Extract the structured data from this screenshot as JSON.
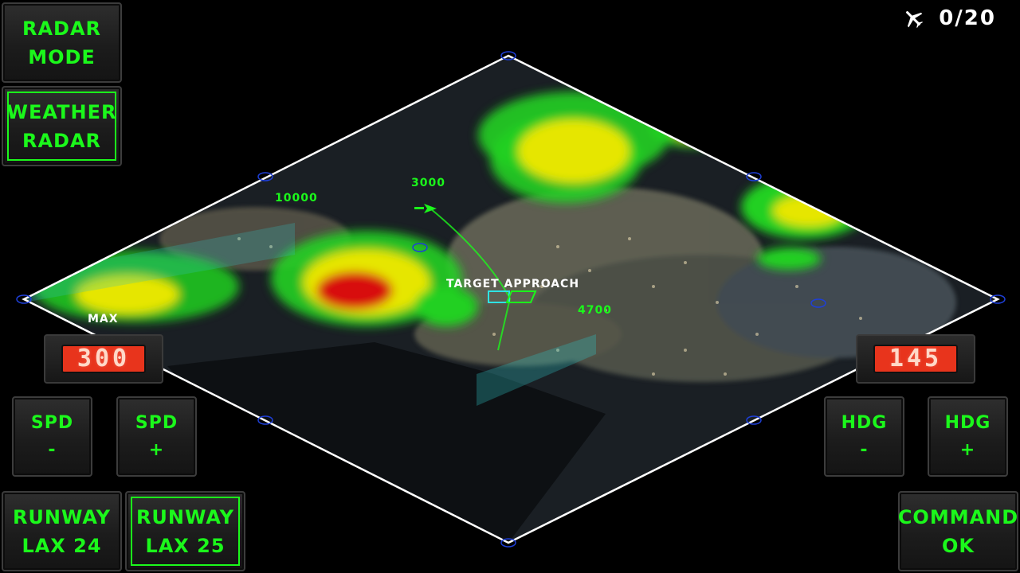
{
  "score": {
    "plane_icon": "airplane-icon",
    "text": "0/20"
  },
  "buttons": {
    "radar_mode": [
      "RADAR",
      "MODE"
    ],
    "weather_radar": [
      "WEATHER",
      "RADAR"
    ],
    "spd_minus": [
      "SPD",
      "-"
    ],
    "spd_plus": [
      "SPD",
      "+"
    ],
    "hdg_minus": [
      "HDG",
      "-"
    ],
    "hdg_plus": [
      "HDG",
      "+"
    ],
    "runway_lax24": [
      "RUNWAY",
      "LAX 24"
    ],
    "runway_lax25": [
      "RUNWAY",
      "LAX 25"
    ],
    "command_ok": [
      "COMMAND",
      "OK"
    ]
  },
  "displays": {
    "speed": "300",
    "heading": "145"
  },
  "map_labels": {
    "alt_10000": "10000",
    "alt_3000": "3000",
    "alt_4700": "4700",
    "target": "TARGET APPROACH",
    "max": "MAX"
  },
  "colors": {
    "accent": "#1bf81b",
    "lcd": "#e8341c",
    "weather_yellow": "#f4f000",
    "weather_red": "#e01010"
  }
}
